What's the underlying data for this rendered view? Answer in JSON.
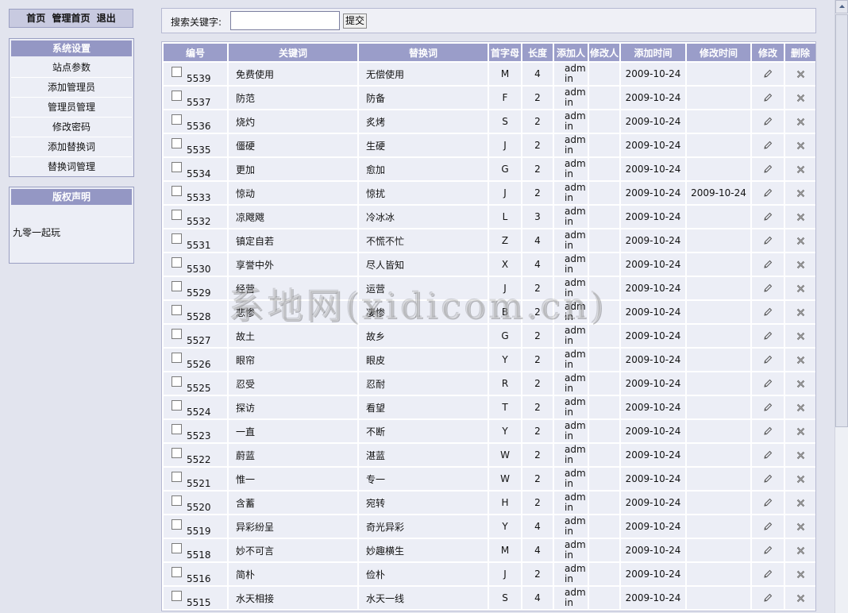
{
  "topnav": {
    "home": "首页",
    "admin_home": "管理首页",
    "logout": "退出"
  },
  "settings": {
    "title": "系统设置",
    "items": [
      "站点参数",
      "添加管理员",
      "管理员管理",
      "修改密码",
      "添加替换词",
      "替换词管理"
    ]
  },
  "copyright": {
    "title": "版权声明",
    "text": "九零一起玩"
  },
  "search": {
    "label": "搜索关键字:",
    "value": "",
    "button": "提交"
  },
  "table": {
    "headers": [
      "编号",
      "关键词",
      "替换词",
      "首字母",
      "长度",
      "添加人",
      "修改人",
      "添加时间",
      "修改时间",
      "修改",
      "删除"
    ],
    "rows": [
      {
        "id": "5539",
        "kw": "免费使用",
        "rep": "无偿使用",
        "letter": "M",
        "len": "4",
        "adder": "admin",
        "modifier": "",
        "added": "2009-10-24",
        "modified": ""
      },
      {
        "id": "5537",
        "kw": "防范",
        "rep": "防备",
        "letter": "F",
        "len": "2",
        "adder": "admin",
        "modifier": "",
        "added": "2009-10-24",
        "modified": ""
      },
      {
        "id": "5536",
        "kw": "烧灼",
        "rep": "炙烤",
        "letter": "S",
        "len": "2",
        "adder": "admin",
        "modifier": "",
        "added": "2009-10-24",
        "modified": ""
      },
      {
        "id": "5535",
        "kw": "僵硬",
        "rep": "生硬",
        "letter": "J",
        "len": "2",
        "adder": "admin",
        "modifier": "",
        "added": "2009-10-24",
        "modified": ""
      },
      {
        "id": "5534",
        "kw": "更加",
        "rep": "愈加",
        "letter": "G",
        "len": "2",
        "adder": "admin",
        "modifier": "",
        "added": "2009-10-24",
        "modified": ""
      },
      {
        "id": "5533",
        "kw": "惊动",
        "rep": "惊扰",
        "letter": "J",
        "len": "2",
        "adder": "admin",
        "modifier": "",
        "added": "2009-10-24",
        "modified": "2009-10-24"
      },
      {
        "id": "5532",
        "kw": "凉飕飕",
        "rep": "冷冰冰",
        "letter": "L",
        "len": "3",
        "adder": "admin",
        "modifier": "",
        "added": "2009-10-24",
        "modified": ""
      },
      {
        "id": "5531",
        "kw": "镇定自若",
        "rep": "不慌不忙",
        "letter": "Z",
        "len": "4",
        "adder": "admin",
        "modifier": "",
        "added": "2009-10-24",
        "modified": ""
      },
      {
        "id": "5530",
        "kw": "享誉中外",
        "rep": "尽人皆知",
        "letter": "X",
        "len": "4",
        "adder": "admin",
        "modifier": "",
        "added": "2009-10-24",
        "modified": ""
      },
      {
        "id": "5529",
        "kw": "经营",
        "rep": "运营",
        "letter": "J",
        "len": "2",
        "adder": "admin",
        "modifier": "",
        "added": "2009-10-24",
        "modified": ""
      },
      {
        "id": "5528",
        "kw": "悲惨",
        "rep": "凄惨",
        "letter": "B",
        "len": "2",
        "adder": "admin",
        "modifier": "",
        "added": "2009-10-24",
        "modified": ""
      },
      {
        "id": "5527",
        "kw": "故土",
        "rep": "故乡",
        "letter": "G",
        "len": "2",
        "adder": "admin",
        "modifier": "",
        "added": "2009-10-24",
        "modified": ""
      },
      {
        "id": "5526",
        "kw": "眼帘",
        "rep": "眼皮",
        "letter": "Y",
        "len": "2",
        "adder": "admin",
        "modifier": "",
        "added": "2009-10-24",
        "modified": ""
      },
      {
        "id": "5525",
        "kw": "忍受",
        "rep": "忍耐",
        "letter": "R",
        "len": "2",
        "adder": "admin",
        "modifier": "",
        "added": "2009-10-24",
        "modified": ""
      },
      {
        "id": "5524",
        "kw": "探访",
        "rep": "看望",
        "letter": "T",
        "len": "2",
        "adder": "admin",
        "modifier": "",
        "added": "2009-10-24",
        "modified": ""
      },
      {
        "id": "5523",
        "kw": "一直",
        "rep": "不断",
        "letter": "Y",
        "len": "2",
        "adder": "admin",
        "modifier": "",
        "added": "2009-10-24",
        "modified": ""
      },
      {
        "id": "5522",
        "kw": "蔚蓝",
        "rep": "湛蓝",
        "letter": "W",
        "len": "2",
        "adder": "admin",
        "modifier": "",
        "added": "2009-10-24",
        "modified": ""
      },
      {
        "id": "5521",
        "kw": "惟一",
        "rep": "专一",
        "letter": "W",
        "len": "2",
        "adder": "admin",
        "modifier": "",
        "added": "2009-10-24",
        "modified": ""
      },
      {
        "id": "5520",
        "kw": "含蓄",
        "rep": "宛转",
        "letter": "H",
        "len": "2",
        "adder": "admin",
        "modifier": "",
        "added": "2009-10-24",
        "modified": ""
      },
      {
        "id": "5519",
        "kw": "异彩纷呈",
        "rep": "奇光异彩",
        "letter": "Y",
        "len": "4",
        "adder": "admin",
        "modifier": "",
        "added": "2009-10-24",
        "modified": ""
      },
      {
        "id": "5518",
        "kw": "妙不可言",
        "rep": "妙趣横生",
        "letter": "M",
        "len": "4",
        "adder": "admin",
        "modifier": "",
        "added": "2009-10-24",
        "modified": ""
      },
      {
        "id": "5516",
        "kw": "简朴",
        "rep": "俭朴",
        "letter": "J",
        "len": "2",
        "adder": "admin",
        "modifier": "",
        "added": "2009-10-24",
        "modified": ""
      },
      {
        "id": "5515",
        "kw": "水天相接",
        "rep": "水天一线",
        "letter": "S",
        "len": "4",
        "adder": "admin",
        "modifier": "",
        "added": "2009-10-24",
        "modified": ""
      }
    ]
  },
  "watermark": "系地网(xidicom.cn)",
  "icons": {
    "edit": "pencil-icon",
    "delete": "x-icon",
    "scroll_up": "arrow-up-icon"
  },
  "colors": {
    "header_bg": "#9a9dc9",
    "row_bg": "#eceef6",
    "page_bg": "#e2e4ee"
  }
}
